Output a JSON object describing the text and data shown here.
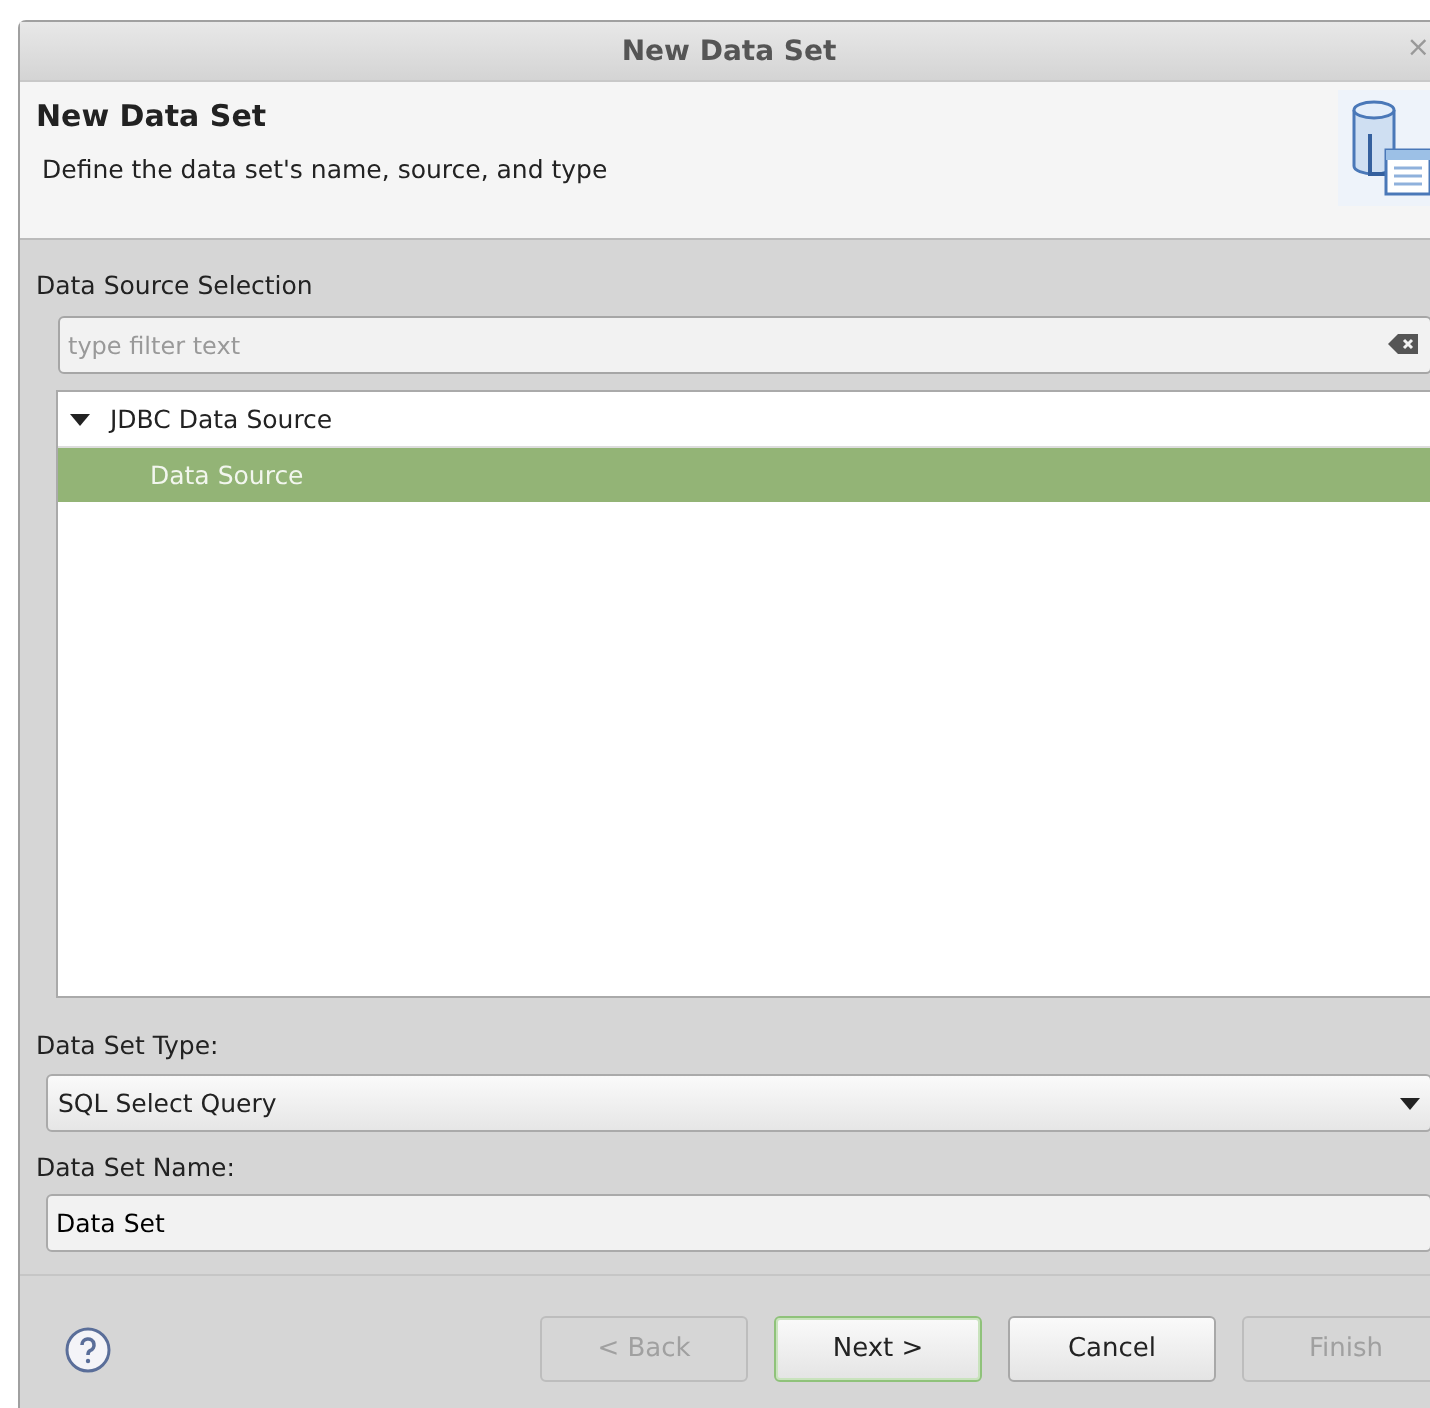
{
  "window": {
    "title": "New Data Set",
    "close": "×"
  },
  "header": {
    "title": "New Data Set",
    "description": "Define the data set's name, source, and type"
  },
  "source_selection": {
    "label": "Data Source Selection",
    "filter": {
      "placeholder": "type filter text"
    },
    "tree": [
      {
        "label": "JDBC Data Source",
        "expanded": true,
        "selected": false,
        "children": [
          {
            "label": "Data Source",
            "selected": true
          }
        ]
      }
    ]
  },
  "type": {
    "label": "Data Set Type:",
    "value": "SQL Select Query"
  },
  "name": {
    "label": "Data Set Name:",
    "value": "Data Set"
  },
  "buttons": [
    {
      "label": "< Back",
      "disabled": true,
      "default": false
    },
    {
      "label": "Next >",
      "disabled": false,
      "default": true
    },
    {
      "label": "Cancel",
      "disabled": false,
      "default": false
    },
    {
      "label": "Finish",
      "disabled": true,
      "default": false
    }
  ]
}
